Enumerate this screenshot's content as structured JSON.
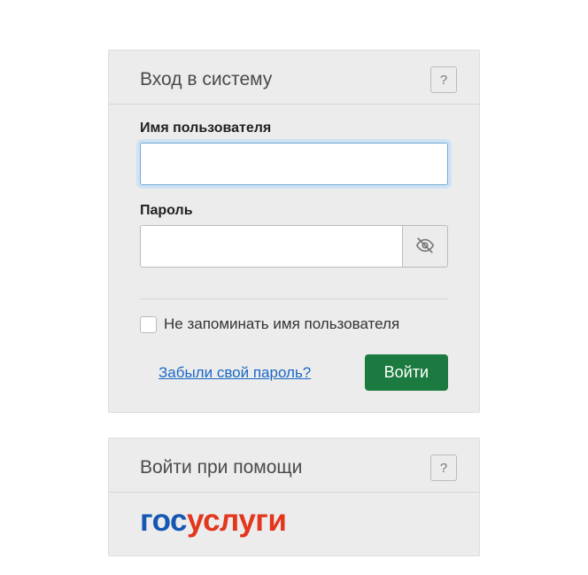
{
  "login": {
    "title": "Вход в систему",
    "help": "?",
    "username_label": "Имя пользователя",
    "username_value": "",
    "password_label": "Пароль",
    "password_value": "",
    "remember_label": "Не запоминать имя пользователя",
    "forgot_link": "Забыли свой пароль?",
    "submit": "Войти"
  },
  "sso": {
    "title": "Войти при помощи",
    "help": "?",
    "provider_part1": "гос",
    "provider_part2": "услуги"
  }
}
